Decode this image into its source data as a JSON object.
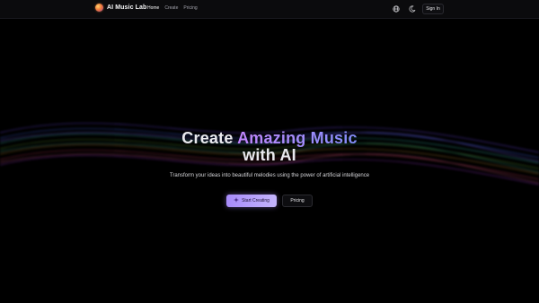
{
  "brand": {
    "name": "AI Music Lab",
    "logo_icon": "music-logo-icon"
  },
  "nav": {
    "items": [
      {
        "label": "Home",
        "active": true
      },
      {
        "label": "Create",
        "active": false
      },
      {
        "label": "Pricing",
        "active": false
      }
    ]
  },
  "header": {
    "signin_label": "Sign In",
    "icons": [
      "globe-icon",
      "moon-icon"
    ]
  },
  "hero": {
    "title_plain_1": "Create ",
    "title_accent": "Amazing Music",
    "title_plain_2": "with AI",
    "subtitle": "Transform your ideas into beautiful melodies using the power of artificial intelligence",
    "primary_label": "Start Creating",
    "primary_icon": "sparkle-icon",
    "secondary_label": "Pricing"
  },
  "colors": {
    "background": "#000000",
    "accent_from": "#c084fc",
    "accent_to": "#818cf8",
    "primary_button": "#a78bfa"
  }
}
